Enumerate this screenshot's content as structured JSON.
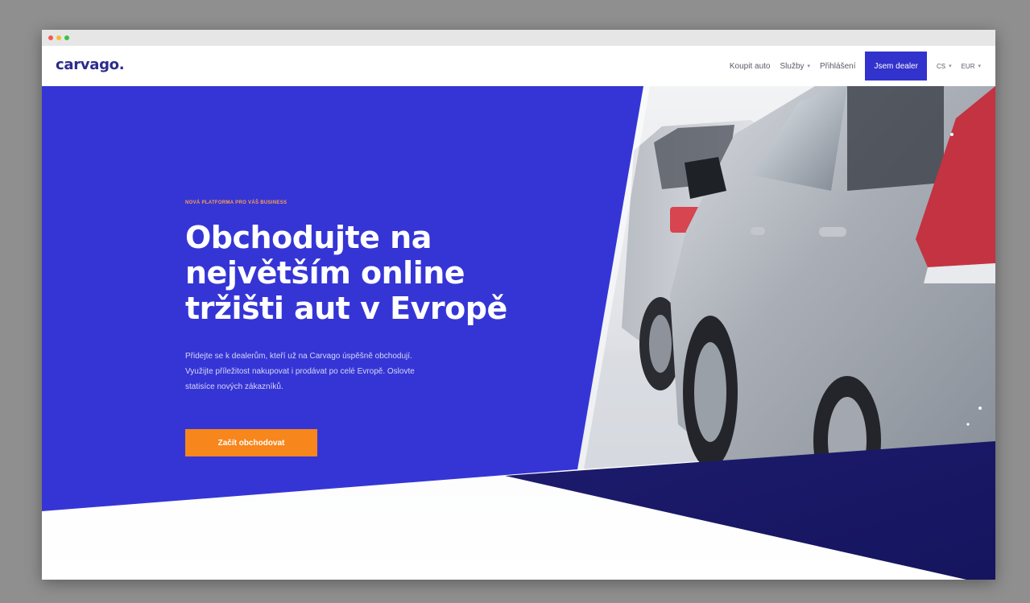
{
  "window": {
    "traffic_lights": [
      "close",
      "minimize",
      "maximize"
    ]
  },
  "nav": {
    "logo": "carvago.",
    "buy_car": "Koupit auto",
    "services": "Služby",
    "login": "Přihlášení",
    "dealer_button": "Jsem dealer",
    "language": "CS",
    "currency": "EUR"
  },
  "hero": {
    "eyebrow": "NOVÁ PLATFORMA PRO VÁŠ BUSINESS",
    "title": "Obchodujte na největším online tržišti aut v Evropě",
    "description": "Přidejte se k dealerům, kteří už na Carvago úspěšně obchodují. Využijte příležitost nakupovat i prodávat po celé Evropě. Oslovte statisíce nových zákazníků.",
    "cta_label": "Začít obchodovat"
  },
  "colors": {
    "brand_blue": "#3535d6",
    "dark_navy": "#1c1b6b",
    "cta_orange": "#f7861c",
    "eyebrow_orange": "#ff9e4c",
    "logo_text": "#2c2c8c"
  },
  "icons": [
    "chevron-down-icon"
  ]
}
